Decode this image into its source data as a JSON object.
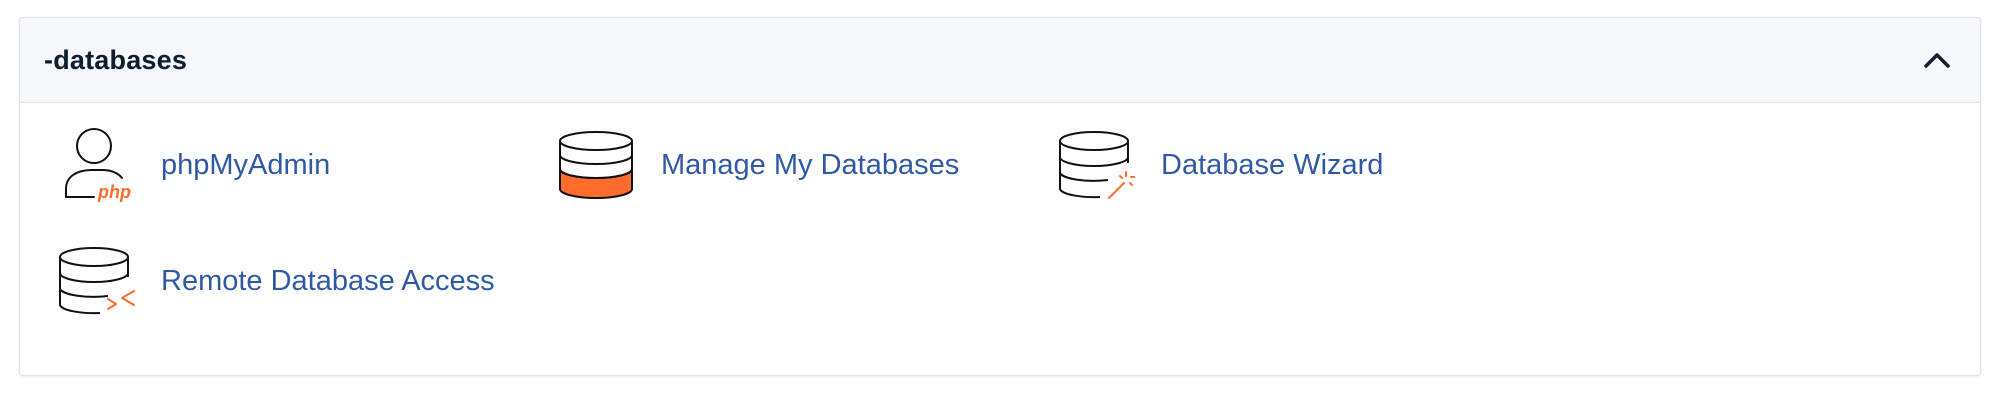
{
  "panel": {
    "title": "-databases",
    "collapse_icon": "chevron-up-icon"
  },
  "tools": [
    {
      "label": "phpMyAdmin",
      "icon": "phpmyadmin-icon",
      "icon_text": "php"
    },
    {
      "label": "Manage My Databases",
      "icon": "database-icon"
    },
    {
      "label": "Database Wizard",
      "icon": "database-wizard-icon"
    },
    {
      "label": "Remote Database Access",
      "icon": "remote-database-icon"
    }
  ],
  "colors": {
    "accent": "#ff6c2c",
    "link": "#2f5aa3",
    "title": "#0f1d2e",
    "header_bg": "#f6f8fb",
    "border": "#dfe3e8"
  }
}
